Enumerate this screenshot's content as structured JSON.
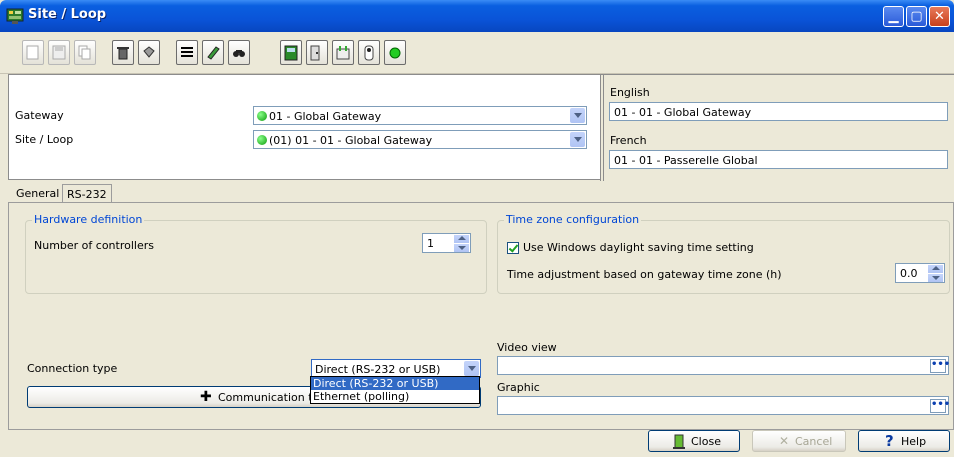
{
  "window": {
    "title": "Site / Loop"
  },
  "toolbar": {
    "buttons": [
      {
        "name": "new-icon"
      },
      {
        "name": "save-icon"
      },
      {
        "name": "copy-icon"
      },
      {
        "name": "delete-icon"
      },
      {
        "name": "print-icon"
      },
      {
        "name": "list-icon"
      },
      {
        "name": "edit-icon"
      },
      {
        "name": "find-icon"
      },
      {
        "name": "controller-icon"
      },
      {
        "name": "door-icon"
      },
      {
        "name": "io-icon"
      },
      {
        "name": "relay-icon"
      },
      {
        "name": "status-icon"
      }
    ]
  },
  "form": {
    "gateway_label": "Gateway",
    "gateway_value": "01 - Global Gateway",
    "site_label": "Site / Loop",
    "site_value": "(01) 01 - 01 - Global Gateway",
    "english_label": "English",
    "english_value": "01 - 01 - Global Gateway",
    "french_label": "French",
    "french_value": "01 - 01 - Passerelle Global"
  },
  "tabs": [
    {
      "label": "General",
      "active": true
    },
    {
      "label": "RS-232",
      "active": false
    }
  ],
  "hardware": {
    "title": "Hardware definition",
    "controllers_label": "Number of controllers",
    "controllers_value": "1"
  },
  "timezone": {
    "title": "Time zone configuration",
    "daylight_label": "Use Windows daylight saving time setting",
    "daylight_checked": true,
    "adjust_label": "Time adjustment based on gateway time zone (h)",
    "adjust_value": "0.0"
  },
  "connection": {
    "label": "Connection type",
    "value": "Direct (RS-232 or USB)",
    "options": [
      "Direct (RS-232 or USB)",
      "Ethernet (polling)"
    ]
  },
  "comm_button": "Communication timing",
  "video": {
    "label": "Video view",
    "value": ""
  },
  "graphic": {
    "label": "Graphic",
    "value": ""
  },
  "footer": {
    "close_label": "Close",
    "cancel_label": "Cancel",
    "help_label": "Help"
  }
}
